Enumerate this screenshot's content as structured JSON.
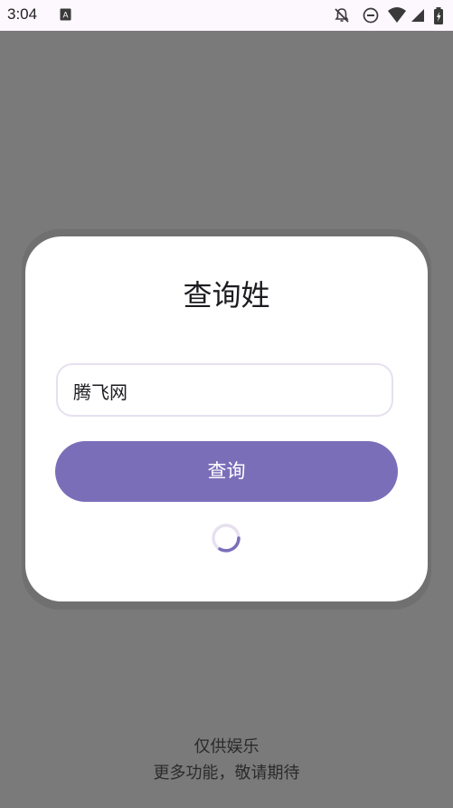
{
  "status_bar": {
    "time": "3:04",
    "icons": [
      "text-a-icon",
      "notifications-off-icon",
      "do-not-disturb-icon",
      "wifi-icon",
      "signal-icon",
      "battery-icon"
    ]
  },
  "dialog": {
    "title": "查询姓",
    "input_value": "腾飞网",
    "button_label": "查询",
    "loading": true
  },
  "footer": {
    "line1": "仅供娱乐",
    "line2": "更多功能，敬请期待"
  },
  "colors": {
    "accent": "#7b6eb9",
    "scrim": "#7a7a7a",
    "input_border": "#e6e0f0"
  }
}
